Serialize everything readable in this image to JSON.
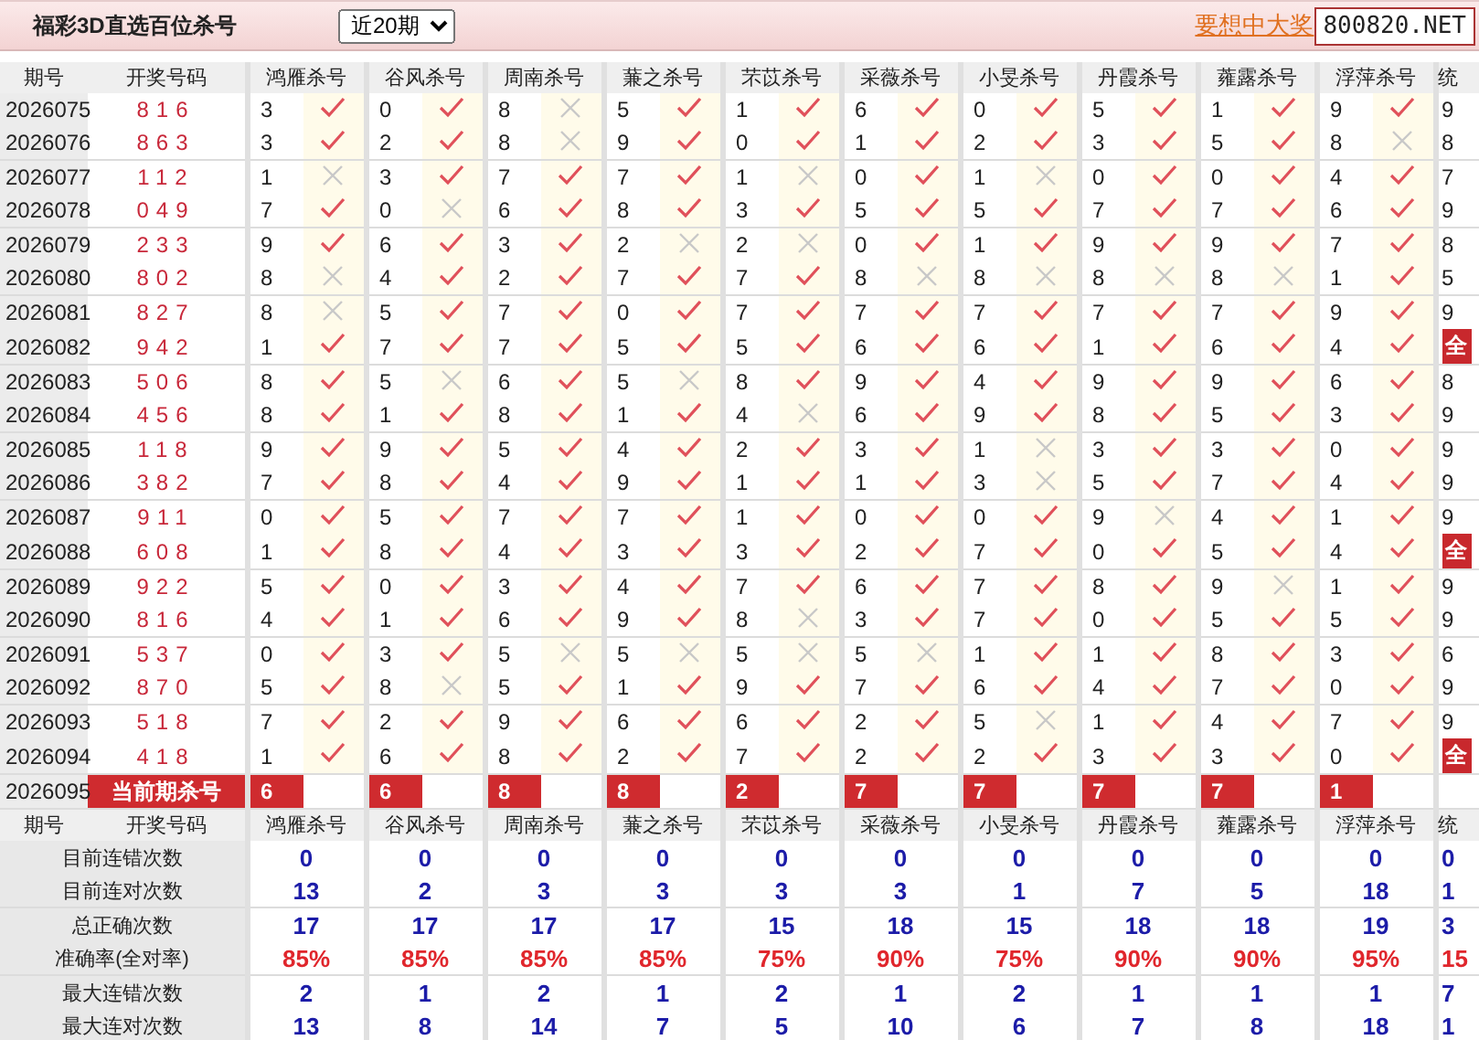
{
  "header": {
    "title": "福彩3D直选百位杀号",
    "period_select": "近20期",
    "promo_link": "要想中大奖",
    "site_badge": "800820.NET"
  },
  "table": {
    "columns": [
      "期号",
      "开奖号码",
      "鸿雁杀号",
      "谷风杀号",
      "周南杀号",
      "蒹之杀号",
      "芣苡杀号",
      "采薇杀号",
      "小旻杀号",
      "丹霞杀号",
      "蕹露杀号",
      "浮萍杀号",
      "统"
    ],
    "rows": [
      {
        "period": "2026075",
        "draw": "816",
        "picks": [
          {
            "number": "3",
            "hit": true
          },
          {
            "number": "0",
            "hit": true
          },
          {
            "number": "8",
            "hit": false
          },
          {
            "number": "5",
            "hit": true
          },
          {
            "number": "1",
            "hit": true
          },
          {
            "number": "6",
            "hit": true
          },
          {
            "number": "0",
            "hit": true
          },
          {
            "number": "5",
            "hit": true
          },
          {
            "number": "1",
            "hit": true
          },
          {
            "number": "9",
            "hit": true
          }
        ],
        "summary": {
          "kind": "text",
          "text": "9"
        }
      },
      {
        "period": "2026076",
        "draw": "863",
        "picks": [
          {
            "number": "3",
            "hit": true
          },
          {
            "number": "2",
            "hit": true
          },
          {
            "number": "8",
            "hit": false
          },
          {
            "number": "9",
            "hit": true
          },
          {
            "number": "0",
            "hit": true
          },
          {
            "number": "1",
            "hit": true
          },
          {
            "number": "2",
            "hit": true
          },
          {
            "number": "3",
            "hit": true
          },
          {
            "number": "5",
            "hit": true
          },
          {
            "number": "8",
            "hit": false
          }
        ],
        "summary": {
          "kind": "text",
          "text": "8"
        }
      },
      {
        "period": "2026077",
        "draw": "112",
        "picks": [
          {
            "number": "1",
            "hit": false
          },
          {
            "number": "3",
            "hit": true
          },
          {
            "number": "7",
            "hit": true
          },
          {
            "number": "7",
            "hit": true
          },
          {
            "number": "1",
            "hit": false
          },
          {
            "number": "0",
            "hit": true
          },
          {
            "number": "1",
            "hit": false
          },
          {
            "number": "0",
            "hit": true
          },
          {
            "number": "0",
            "hit": true
          },
          {
            "number": "4",
            "hit": true
          }
        ],
        "summary": {
          "kind": "text",
          "text": "7"
        }
      },
      {
        "period": "2026078",
        "draw": "049",
        "picks": [
          {
            "number": "7",
            "hit": true
          },
          {
            "number": "0",
            "hit": false
          },
          {
            "number": "6",
            "hit": true
          },
          {
            "number": "8",
            "hit": true
          },
          {
            "number": "3",
            "hit": true
          },
          {
            "number": "5",
            "hit": true
          },
          {
            "number": "5",
            "hit": true
          },
          {
            "number": "7",
            "hit": true
          },
          {
            "number": "7",
            "hit": true
          },
          {
            "number": "6",
            "hit": true
          }
        ],
        "summary": {
          "kind": "text",
          "text": "9"
        }
      },
      {
        "period": "2026079",
        "draw": "233",
        "picks": [
          {
            "number": "9",
            "hit": true
          },
          {
            "number": "6",
            "hit": true
          },
          {
            "number": "3",
            "hit": true
          },
          {
            "number": "2",
            "hit": false
          },
          {
            "number": "2",
            "hit": false
          },
          {
            "number": "0",
            "hit": true
          },
          {
            "number": "1",
            "hit": true
          },
          {
            "number": "9",
            "hit": true
          },
          {
            "number": "9",
            "hit": true
          },
          {
            "number": "7",
            "hit": true
          }
        ],
        "summary": {
          "kind": "text",
          "text": "8"
        }
      },
      {
        "period": "2026080",
        "draw": "802",
        "picks": [
          {
            "number": "8",
            "hit": false
          },
          {
            "number": "4",
            "hit": true
          },
          {
            "number": "2",
            "hit": true
          },
          {
            "number": "7",
            "hit": true
          },
          {
            "number": "7",
            "hit": true
          },
          {
            "number": "8",
            "hit": false
          },
          {
            "number": "8",
            "hit": false
          },
          {
            "number": "8",
            "hit": false
          },
          {
            "number": "8",
            "hit": false
          },
          {
            "number": "1",
            "hit": true
          }
        ],
        "summary": {
          "kind": "text",
          "text": "5"
        }
      },
      {
        "period": "2026081",
        "draw": "827",
        "picks": [
          {
            "number": "8",
            "hit": false
          },
          {
            "number": "5",
            "hit": true
          },
          {
            "number": "7",
            "hit": true
          },
          {
            "number": "0",
            "hit": true
          },
          {
            "number": "7",
            "hit": true
          },
          {
            "number": "7",
            "hit": true
          },
          {
            "number": "7",
            "hit": true
          },
          {
            "number": "7",
            "hit": true
          },
          {
            "number": "7",
            "hit": true
          },
          {
            "number": "9",
            "hit": true
          }
        ],
        "summary": {
          "kind": "text",
          "text": "9"
        }
      },
      {
        "period": "2026082",
        "draw": "942",
        "picks": [
          {
            "number": "1",
            "hit": true
          },
          {
            "number": "7",
            "hit": true
          },
          {
            "number": "7",
            "hit": true
          },
          {
            "number": "5",
            "hit": true
          },
          {
            "number": "5",
            "hit": true
          },
          {
            "number": "6",
            "hit": true
          },
          {
            "number": "6",
            "hit": true
          },
          {
            "number": "1",
            "hit": true
          },
          {
            "number": "6",
            "hit": true
          },
          {
            "number": "4",
            "hit": true
          }
        ],
        "summary": {
          "kind": "badge",
          "text": "全"
        }
      },
      {
        "period": "2026083",
        "draw": "506",
        "picks": [
          {
            "number": "8",
            "hit": true
          },
          {
            "number": "5",
            "hit": false
          },
          {
            "number": "6",
            "hit": true
          },
          {
            "number": "5",
            "hit": false
          },
          {
            "number": "8",
            "hit": true
          },
          {
            "number": "9",
            "hit": true
          },
          {
            "number": "4",
            "hit": true
          },
          {
            "number": "9",
            "hit": true
          },
          {
            "number": "9",
            "hit": true
          },
          {
            "number": "6",
            "hit": true
          }
        ],
        "summary": {
          "kind": "text",
          "text": "8"
        }
      },
      {
        "period": "2026084",
        "draw": "456",
        "picks": [
          {
            "number": "8",
            "hit": true
          },
          {
            "number": "1",
            "hit": true
          },
          {
            "number": "8",
            "hit": true
          },
          {
            "number": "1",
            "hit": true
          },
          {
            "number": "4",
            "hit": false
          },
          {
            "number": "6",
            "hit": true
          },
          {
            "number": "9",
            "hit": true
          },
          {
            "number": "8",
            "hit": true
          },
          {
            "number": "5",
            "hit": true
          },
          {
            "number": "3",
            "hit": true
          }
        ],
        "summary": {
          "kind": "text",
          "text": "9"
        }
      },
      {
        "period": "2026085",
        "draw": "118",
        "picks": [
          {
            "number": "9",
            "hit": true
          },
          {
            "number": "9",
            "hit": true
          },
          {
            "number": "5",
            "hit": true
          },
          {
            "number": "4",
            "hit": true
          },
          {
            "number": "2",
            "hit": true
          },
          {
            "number": "3",
            "hit": true
          },
          {
            "number": "1",
            "hit": false
          },
          {
            "number": "3",
            "hit": true
          },
          {
            "number": "3",
            "hit": true
          },
          {
            "number": "0",
            "hit": true
          }
        ],
        "summary": {
          "kind": "text",
          "text": "9"
        }
      },
      {
        "period": "2026086",
        "draw": "382",
        "picks": [
          {
            "number": "7",
            "hit": true
          },
          {
            "number": "8",
            "hit": true
          },
          {
            "number": "4",
            "hit": true
          },
          {
            "number": "9",
            "hit": true
          },
          {
            "number": "1",
            "hit": true
          },
          {
            "number": "1",
            "hit": true
          },
          {
            "number": "3",
            "hit": false
          },
          {
            "number": "5",
            "hit": true
          },
          {
            "number": "7",
            "hit": true
          },
          {
            "number": "4",
            "hit": true
          }
        ],
        "summary": {
          "kind": "text",
          "text": "9"
        }
      },
      {
        "period": "2026087",
        "draw": "911",
        "picks": [
          {
            "number": "0",
            "hit": true
          },
          {
            "number": "5",
            "hit": true
          },
          {
            "number": "7",
            "hit": true
          },
          {
            "number": "7",
            "hit": true
          },
          {
            "number": "1",
            "hit": true
          },
          {
            "number": "0",
            "hit": true
          },
          {
            "number": "0",
            "hit": true
          },
          {
            "number": "9",
            "hit": false
          },
          {
            "number": "4",
            "hit": true
          },
          {
            "number": "1",
            "hit": true
          }
        ],
        "summary": {
          "kind": "text",
          "text": "9"
        }
      },
      {
        "period": "2026088",
        "draw": "608",
        "picks": [
          {
            "number": "1",
            "hit": true
          },
          {
            "number": "8",
            "hit": true
          },
          {
            "number": "4",
            "hit": true
          },
          {
            "number": "3",
            "hit": true
          },
          {
            "number": "3",
            "hit": true
          },
          {
            "number": "2",
            "hit": true
          },
          {
            "number": "7",
            "hit": true
          },
          {
            "number": "0",
            "hit": true
          },
          {
            "number": "5",
            "hit": true
          },
          {
            "number": "4",
            "hit": true
          }
        ],
        "summary": {
          "kind": "badge",
          "text": "全"
        }
      },
      {
        "period": "2026089",
        "draw": "922",
        "picks": [
          {
            "number": "5",
            "hit": true
          },
          {
            "number": "0",
            "hit": true
          },
          {
            "number": "3",
            "hit": true
          },
          {
            "number": "4",
            "hit": true
          },
          {
            "number": "7",
            "hit": true
          },
          {
            "number": "6",
            "hit": true
          },
          {
            "number": "7",
            "hit": true
          },
          {
            "number": "8",
            "hit": true
          },
          {
            "number": "9",
            "hit": false
          },
          {
            "number": "1",
            "hit": true
          }
        ],
        "summary": {
          "kind": "text",
          "text": "9"
        }
      },
      {
        "period": "2026090",
        "draw": "816",
        "picks": [
          {
            "number": "4",
            "hit": true
          },
          {
            "number": "1",
            "hit": true
          },
          {
            "number": "6",
            "hit": true
          },
          {
            "number": "9",
            "hit": true
          },
          {
            "number": "8",
            "hit": false
          },
          {
            "number": "3",
            "hit": true
          },
          {
            "number": "7",
            "hit": true
          },
          {
            "number": "0",
            "hit": true
          },
          {
            "number": "5",
            "hit": true
          },
          {
            "number": "5",
            "hit": true
          }
        ],
        "summary": {
          "kind": "text",
          "text": "9"
        }
      },
      {
        "period": "2026091",
        "draw": "537",
        "picks": [
          {
            "number": "0",
            "hit": true
          },
          {
            "number": "3",
            "hit": true
          },
          {
            "number": "5",
            "hit": false
          },
          {
            "number": "5",
            "hit": false
          },
          {
            "number": "5",
            "hit": false
          },
          {
            "number": "5",
            "hit": false
          },
          {
            "number": "1",
            "hit": true
          },
          {
            "number": "1",
            "hit": true
          },
          {
            "number": "8",
            "hit": true
          },
          {
            "number": "3",
            "hit": true
          }
        ],
        "summary": {
          "kind": "text",
          "text": "6"
        }
      },
      {
        "period": "2026092",
        "draw": "870",
        "picks": [
          {
            "number": "5",
            "hit": true
          },
          {
            "number": "8",
            "hit": false
          },
          {
            "number": "5",
            "hit": true
          },
          {
            "number": "1",
            "hit": true
          },
          {
            "number": "9",
            "hit": true
          },
          {
            "number": "7",
            "hit": true
          },
          {
            "number": "6",
            "hit": true
          },
          {
            "number": "4",
            "hit": true
          },
          {
            "number": "7",
            "hit": true
          },
          {
            "number": "0",
            "hit": true
          }
        ],
        "summary": {
          "kind": "text",
          "text": "9"
        }
      },
      {
        "period": "2026093",
        "draw": "518",
        "picks": [
          {
            "number": "7",
            "hit": true
          },
          {
            "number": "2",
            "hit": true
          },
          {
            "number": "9",
            "hit": true
          },
          {
            "number": "6",
            "hit": true
          },
          {
            "number": "6",
            "hit": true
          },
          {
            "number": "2",
            "hit": true
          },
          {
            "number": "5",
            "hit": false
          },
          {
            "number": "1",
            "hit": true
          },
          {
            "number": "4",
            "hit": true
          },
          {
            "number": "7",
            "hit": true
          }
        ],
        "summary": {
          "kind": "text",
          "text": "9"
        }
      },
      {
        "period": "2026094",
        "draw": "418",
        "picks": [
          {
            "number": "1",
            "hit": true
          },
          {
            "number": "6",
            "hit": true
          },
          {
            "number": "8",
            "hit": true
          },
          {
            "number": "2",
            "hit": true
          },
          {
            "number": "7",
            "hit": true
          },
          {
            "number": "2",
            "hit": true
          },
          {
            "number": "2",
            "hit": true
          },
          {
            "number": "3",
            "hit": true
          },
          {
            "number": "3",
            "hit": true
          },
          {
            "number": "0",
            "hit": true
          }
        ],
        "summary": {
          "kind": "badge",
          "text": "全"
        }
      }
    ],
    "current": {
      "period": "2026095",
      "label": "当前期杀号",
      "kills": [
        "6",
        "6",
        "8",
        "8",
        "2",
        "7",
        "7",
        "7",
        "7",
        "1"
      ]
    }
  },
  "stats": {
    "columns": [
      "期号",
      "开奖号码",
      "鸿雁杀号",
      "谷风杀号",
      "周南杀号",
      "蒹之杀号",
      "芣苡杀号",
      "采薇杀号",
      "小旻杀号",
      "丹霞杀号",
      "蕹露杀号",
      "浮萍杀号",
      "统"
    ],
    "rows": [
      {
        "label": "目前连错次数",
        "kind": "count",
        "values": [
          "0",
          "0",
          "0",
          "0",
          "0",
          "0",
          "0",
          "0",
          "0",
          "0"
        ],
        "summary": "0"
      },
      {
        "label": "目前连对次数",
        "kind": "count",
        "values": [
          "13",
          "2",
          "3",
          "3",
          "3",
          "3",
          "1",
          "7",
          "5",
          "18"
        ],
        "summary": "1"
      },
      {
        "label": "总正确次数",
        "kind": "count",
        "values": [
          "17",
          "17",
          "17",
          "17",
          "15",
          "18",
          "15",
          "18",
          "18",
          "19"
        ],
        "summary": "3"
      },
      {
        "label": "准确率(全对率)",
        "kind": "rate",
        "values": [
          "85%",
          "85%",
          "85%",
          "85%",
          "75%",
          "90%",
          "75%",
          "90%",
          "90%",
          "95%"
        ],
        "summary": "15"
      },
      {
        "label": "最大连错次数",
        "kind": "count",
        "values": [
          "2",
          "1",
          "2",
          "1",
          "2",
          "1",
          "2",
          "1",
          "1",
          "1"
        ],
        "summary": "7"
      },
      {
        "label": "最大连对次数",
        "kind": "count",
        "values": [
          "13",
          "8",
          "14",
          "7",
          "5",
          "10",
          "6",
          "7",
          "8",
          "18"
        ],
        "summary": "1"
      }
    ]
  }
}
